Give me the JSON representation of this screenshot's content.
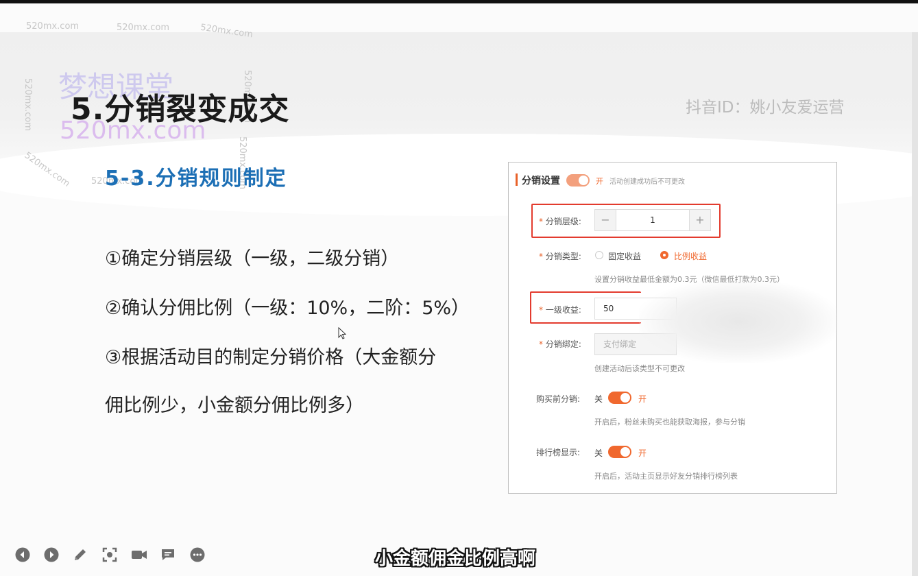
{
  "slide": {
    "title": "5.分销裂变成交",
    "subtitle": "5-3.分销规则制定",
    "douyin_id": "抖音ID：姚小友爱运营",
    "bullets": [
      "①确定分销层级（一级，二级分销）",
      "②确认分佣比例（一级：10%，二阶：5%）",
      "③根据活动目的制定分销价格（大金额分",
      "佣比例少，小金额分佣比例多）"
    ]
  },
  "watermarks": {
    "small": "520mx.com",
    "big_cn": "梦想课堂",
    "big_url": "520mx.com"
  },
  "settings_panel": {
    "header": "分销设置",
    "header_toggle_on": "开",
    "header_note": "活动创建成功后不可更改",
    "level": {
      "label": "分销层级:",
      "value": "1",
      "minus": "−",
      "plus": "+"
    },
    "type": {
      "label": "分销类型:",
      "option_fixed": "固定收益",
      "option_ratio": "比例收益",
      "selected": "比例收益",
      "hint": "设置分销收益最低金额为0.3元（微信最低打款为0.3元）"
    },
    "first_level_income": {
      "label": "一级收益:",
      "value": "50"
    },
    "binding": {
      "label": "分销绑定:",
      "placeholder": "支付绑定",
      "hint": "创建活动后该类型不可更改"
    },
    "pre_purchase": {
      "label": "购买前分销:",
      "off": "关",
      "on": "开",
      "hint": "开启后，粉丝未购买也能获取海报，参与分销"
    },
    "ranking": {
      "label": "排行榜显示:",
      "off": "关",
      "on": "开",
      "hint": "开启后，活动主页显示好友分销排行榜列表"
    }
  },
  "toolbar": {
    "icons": [
      "prev-icon",
      "next-icon",
      "pen-icon",
      "screenshot-icon",
      "camera-icon",
      "comment-icon",
      "more-icon"
    ]
  },
  "caption": "小金额佣金比例高啊"
}
